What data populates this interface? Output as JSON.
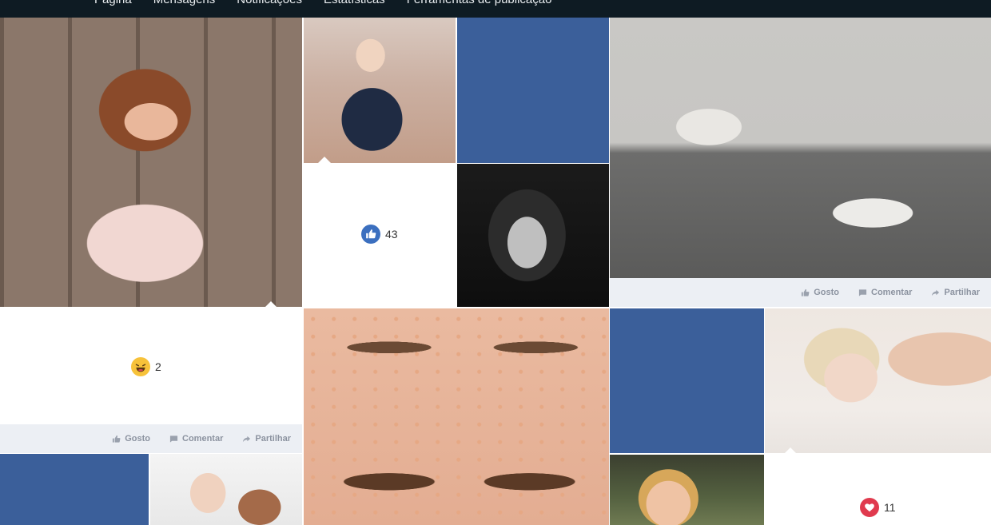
{
  "nav": {
    "items": [
      "Página",
      "Mensagens",
      "Notificações",
      "Estatísticas",
      "Ferramentas de publicação"
    ]
  },
  "reactions": {
    "like": {
      "icon": "thumbs-up-icon",
      "count": "43"
    },
    "haha": {
      "icon": "laughing-emoji-icon",
      "count": "2"
    },
    "love": {
      "icon": "heart-icon",
      "count": "11"
    }
  },
  "actions": {
    "like_label": "Gosto",
    "comment_label": "Comentar",
    "share_label": "Partilhar"
  },
  "colors": {
    "topbar": "#0e1b23",
    "blue_tile": "#3b5f9a",
    "action_bar": "#eceff4",
    "like": "#3b6fbf",
    "haha": "#f7c23a",
    "love": "#e03a4e"
  }
}
